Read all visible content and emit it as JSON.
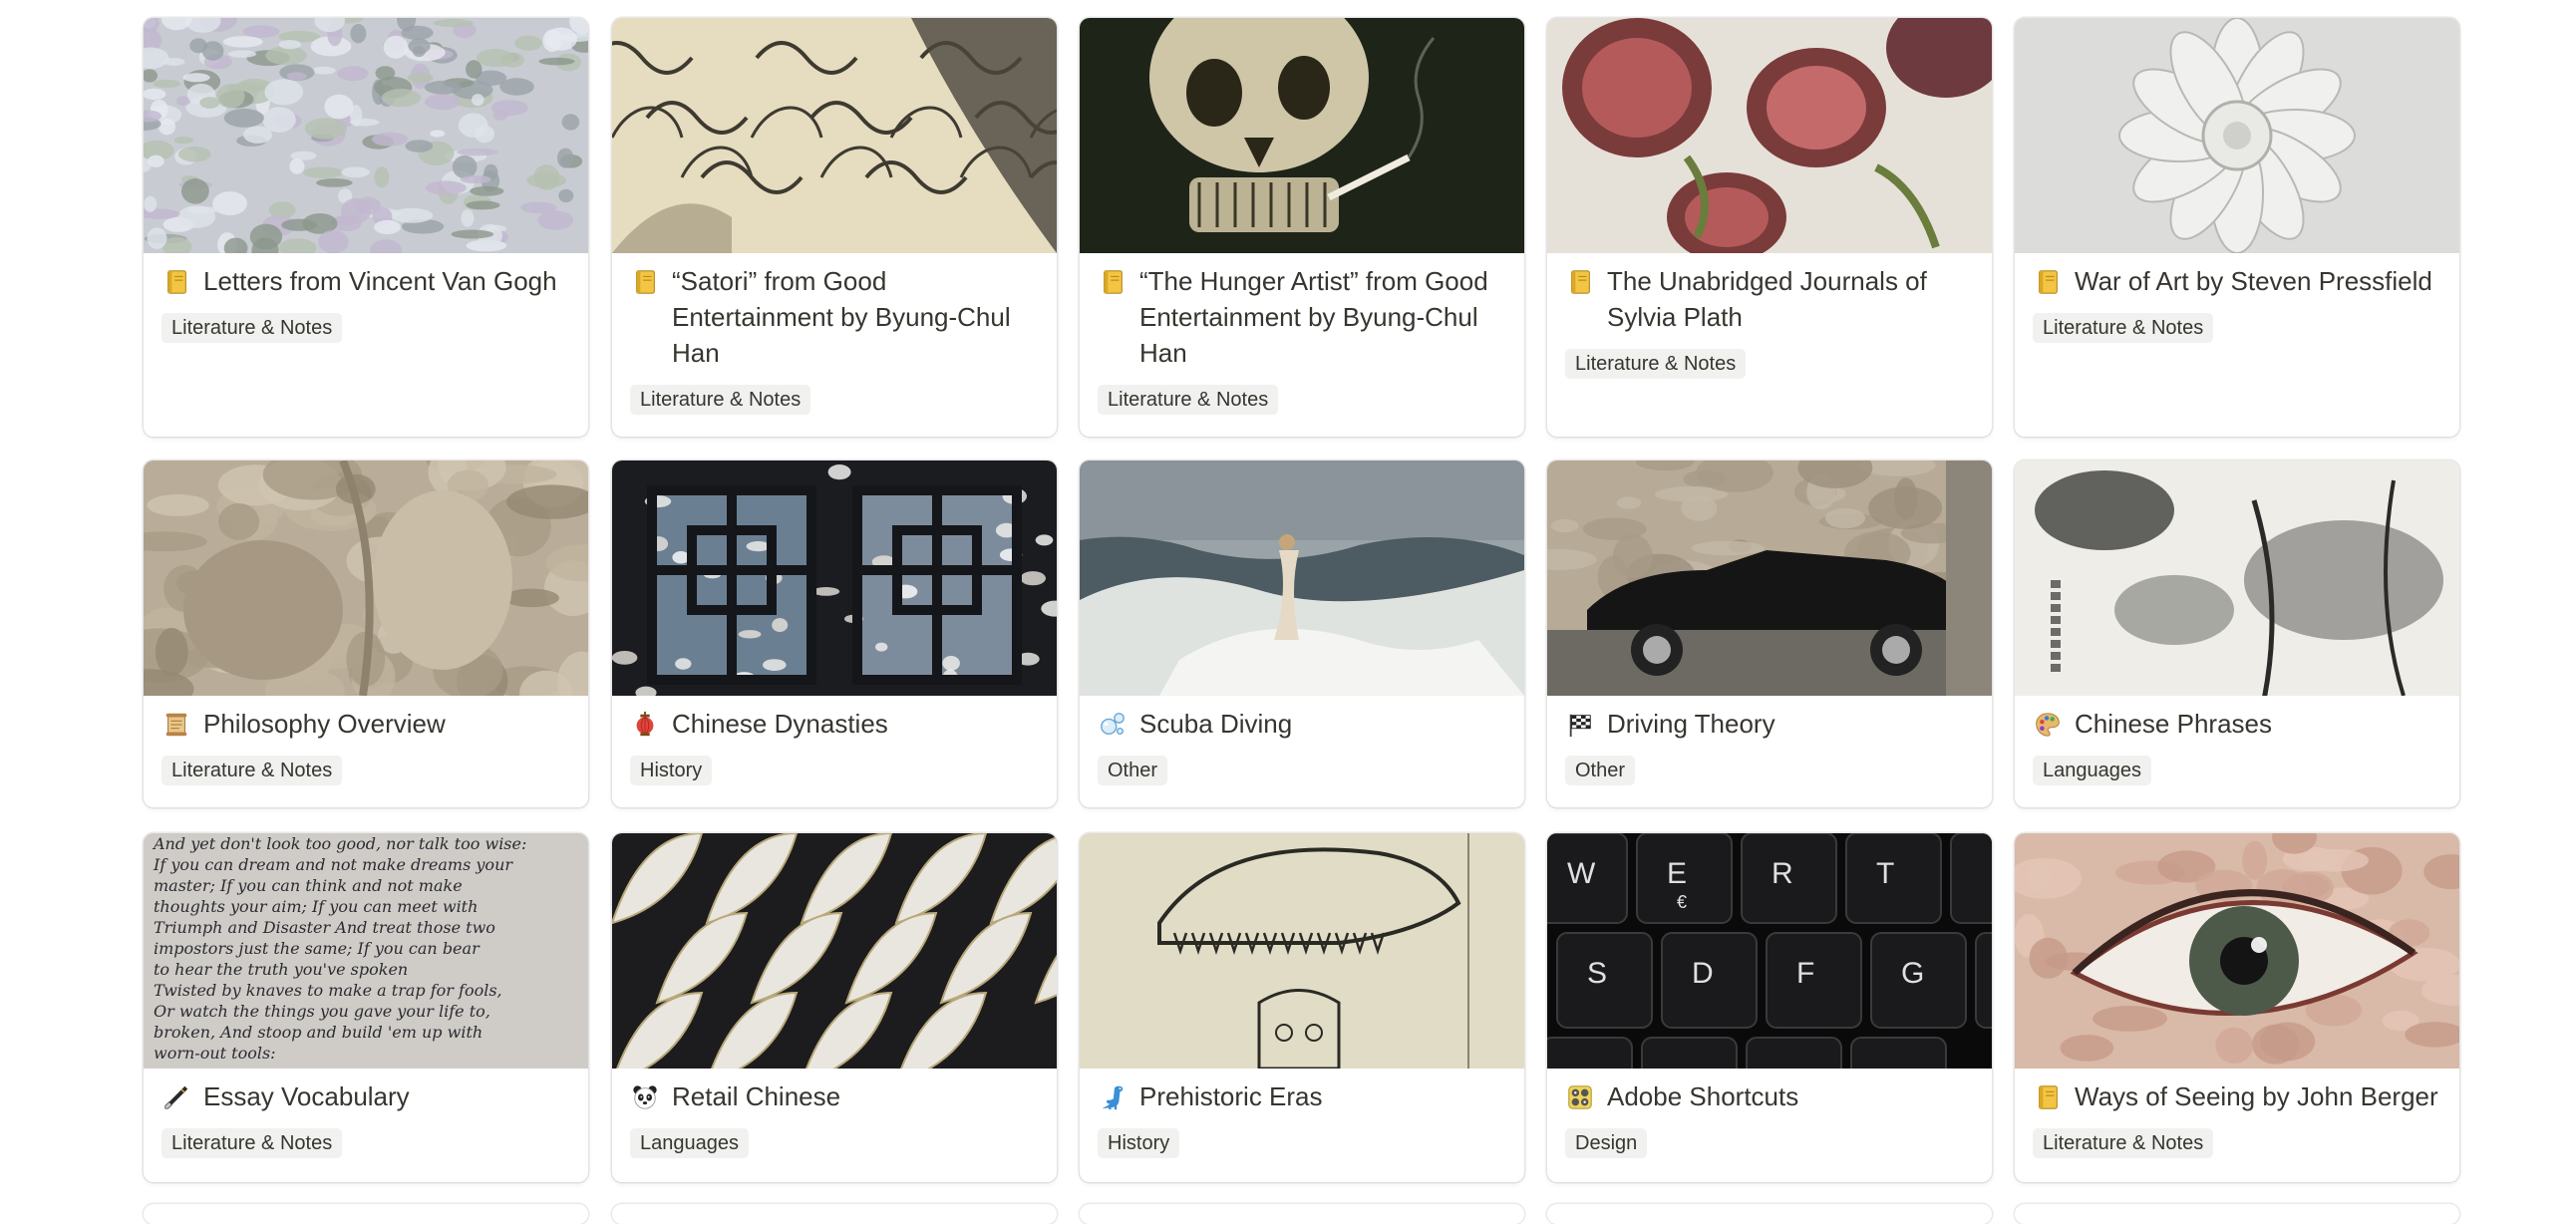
{
  "gallery": {
    "cards": [
      {
        "title": "Letters from Vincent Van Gogh",
        "tag": "Literature & Notes",
        "icon": "notebook-icon",
        "cover": "impressionist-water-painting"
      },
      {
        "title": "“Satori” from Good Entertainment by Byung-Chul Han",
        "tag": "Literature & Notes",
        "icon": "notebook-icon",
        "cover": "japanese-wave-print"
      },
      {
        "title": "“The Hunger Artist” from Good Entertainment by Byung-Chul Han",
        "tag": "Literature & Notes",
        "icon": "notebook-icon",
        "cover": "skull-with-cigarette-painting"
      },
      {
        "title": "The Unabridged Journals of Sylvia Plath",
        "tag": "Literature & Notes",
        "icon": "notebook-icon",
        "cover": "sliced-figs-photo"
      },
      {
        "title": "War of Art by Steven Pressfield",
        "tag": "Literature & Notes",
        "icon": "notebook-icon",
        "cover": "white-plaster-rosette"
      },
      {
        "title": "Philosophy Overview",
        "tag": "Literature & Notes",
        "icon": "scroll-icon",
        "cover": "stone-relief-sculpture"
      },
      {
        "title": "Chinese Dynasties",
        "tag": "History",
        "icon": "lantern-icon",
        "cover": "lattice-window-magnolias"
      },
      {
        "title": "Scuba Diving",
        "tag": "Other",
        "icon": "bubbles-icon",
        "cover": "stormy-sea-painting"
      },
      {
        "title": "Driving Theory",
        "tag": "Other",
        "icon": "checkered-flag-icon",
        "cover": "black-convertible-car"
      },
      {
        "title": "Chinese Phrases",
        "tag": "Languages",
        "icon": "palette-icon",
        "cover": "ink-brush-lotus-painting"
      },
      {
        "title": "Essay Vocabulary",
        "tag": "Literature & Notes",
        "icon": "fountain-pen-icon",
        "cover": "handwritten-poem"
      },
      {
        "title": "Retail Chinese",
        "tag": "Languages",
        "icon": "panda-icon",
        "cover": "embroidered-feathers"
      },
      {
        "title": "Prehistoric Eras",
        "tag": "History",
        "icon": "dinosaur-icon",
        "cover": "dinosaur-skull-sketch"
      },
      {
        "title": "Adobe Shortcuts",
        "tag": "Design",
        "icon": "control-knobs-icon",
        "cover": "keyboard-keys-closeup"
      },
      {
        "title": "Ways of Seeing by John Berger",
        "tag": "Literature & Notes",
        "icon": "notebook-icon",
        "cover": "painted-eye-closeup"
      }
    ],
    "keyboard_keys": [
      "W",
      "E",
      "R",
      "T",
      "S",
      "D",
      "F",
      "G"
    ],
    "keyboard_sub": "€",
    "handwriting": [
      "And yet don't look too good, nor talk too wise:",
      "If you can dream and not make dreams your",
      "master; If you can think and not make",
      "thoughts your aim; If you can meet with",
      "Triumph and Disaster And treat those two",
      "impostors just the same; If you can bear",
      "to hear the truth you've spoken",
      "Twisted by knaves to make a trap for fools,",
      "Or watch the things you gave your life to,",
      "broken, And stoop and build 'em up with",
      "worn-out tools:"
    ]
  }
}
